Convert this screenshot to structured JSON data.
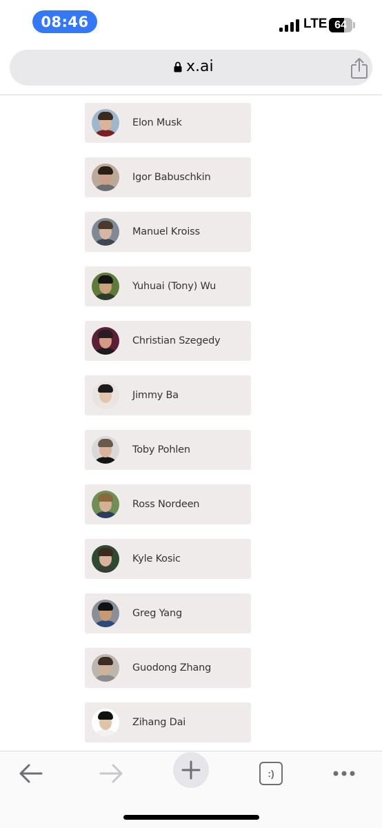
{
  "status_bar": {
    "time": "08:46",
    "network": "LTE",
    "battery_percent": "64",
    "battery_level": 0.64
  },
  "address_bar": {
    "url": "x.ai",
    "lock_icon": "lock-icon",
    "share_icon": "share-icon"
  },
  "team": [
    {
      "name": "Elon Musk",
      "skin": "#d9b39a",
      "hair": "#3a2a20",
      "shirt": "#7a1f22",
      "bg": "#9fb6cc"
    },
    {
      "name": "Igor Babuschkin",
      "skin": "#caa08a",
      "hair": "#2b1e16",
      "shirt": "#6b6f72",
      "bg": "#bba99a"
    },
    {
      "name": "Manuel Kroiss",
      "skin": "#d7b7a4",
      "hair": "#4a3a2e",
      "shirt": "#3f4752",
      "bg": "#7f8a94"
    },
    {
      "name": "Yuhuai (Tony) Wu",
      "skin": "#c9a27e",
      "hair": "#151515",
      "shirt": "#2f3b2a",
      "bg": "#5f7a3a"
    },
    {
      "name": "Christian Szegedy",
      "skin": "#d59a84",
      "hair": "#2a1c22",
      "shirt": "#1c1c1c",
      "bg": "#5a2038"
    },
    {
      "name": "Jimmy Ba",
      "skin": "#e3c6ae",
      "hair": "#1b1b1b",
      "shirt": "#ece6e2",
      "bg": "#e9e4df"
    },
    {
      "name": "Toby Pohlen",
      "skin": "#dab39c",
      "hair": "#6a5a4c",
      "shirt": "#151515",
      "bg": "#d9d9d9"
    },
    {
      "name": "Ross Nordeen",
      "skin": "#d6b093",
      "hair": "#8a6a3c",
      "shirt": "#2b3f5c",
      "bg": "#6f8f57"
    },
    {
      "name": "Kyle Kosic",
      "skin": "#d8b29a",
      "hair": "#3b2b1f",
      "shirt": "#344034",
      "bg": "#2f4a30"
    },
    {
      "name": "Greg Yang",
      "skin": "#c79a73",
      "hair": "#111111",
      "shirt": "#2e4a7a",
      "bg": "#8a8f96"
    },
    {
      "name": "Guodong Zhang",
      "skin": "#cdb29c",
      "hair": "#3a2e27",
      "shirt": "#8c8c8c",
      "bg": "#bdb6ad"
    },
    {
      "name": "Zihang Dai",
      "skin": "#e0c4a8",
      "hair": "#111111",
      "shirt": "#f2f2f2",
      "bg": "#ffffff"
    }
  ],
  "toolbar": {
    "back_icon": "back-arrow-icon",
    "forward_icon": "forward-arrow-icon",
    "new_tab_icon": "plus-icon",
    "tabs_label": ":)",
    "more_icon": "more-dots-icon"
  }
}
